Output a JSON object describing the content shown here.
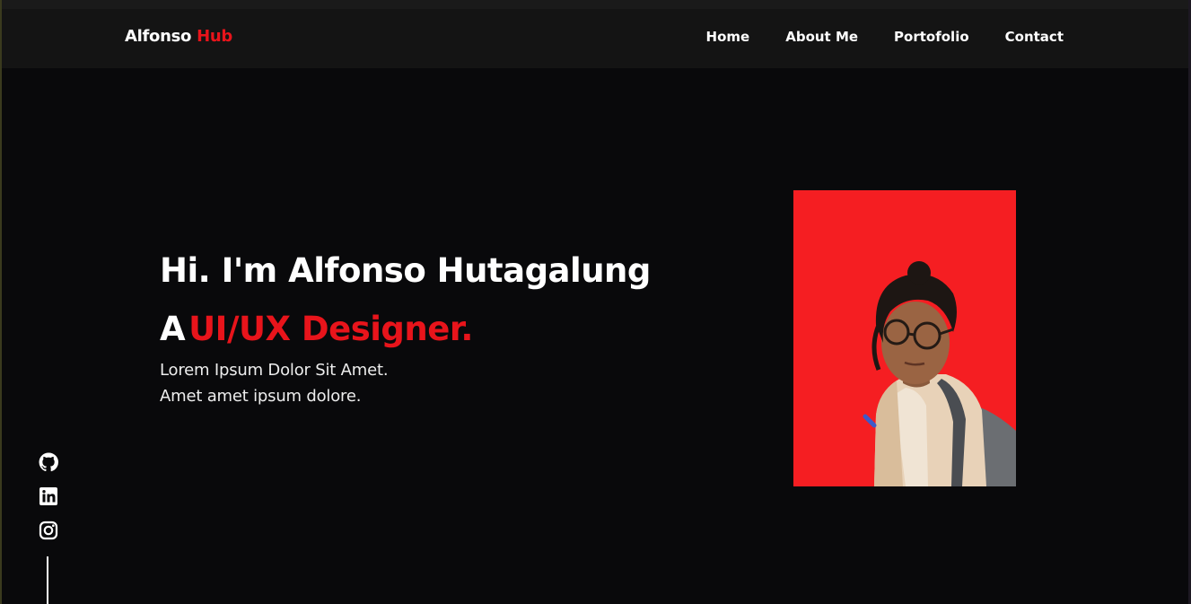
{
  "header": {
    "brand_first": "Alfonso",
    "brand_second": "Hub",
    "nav": [
      {
        "label": "Home"
      },
      {
        "label": "About Me"
      },
      {
        "label": "Portofolio"
      },
      {
        "label": "Contact"
      }
    ]
  },
  "hero": {
    "title": "Hi. I'm Alfonso Hutagalung",
    "role_prefix": "A",
    "role": "UI/UX Designer.",
    "desc_line1": "Lorem Ipsum Dolor Sit Amet.",
    "desc_line2": "Amet amet ipsum dolore."
  },
  "socials": [
    {
      "icon": "github-icon"
    },
    {
      "icon": "linkedin-icon"
    },
    {
      "icon": "instagram-icon"
    }
  ],
  "colors": {
    "accent": "#e8141b",
    "background": "#09090b",
    "header": "#141414",
    "photo_bg": "#f51e22"
  }
}
